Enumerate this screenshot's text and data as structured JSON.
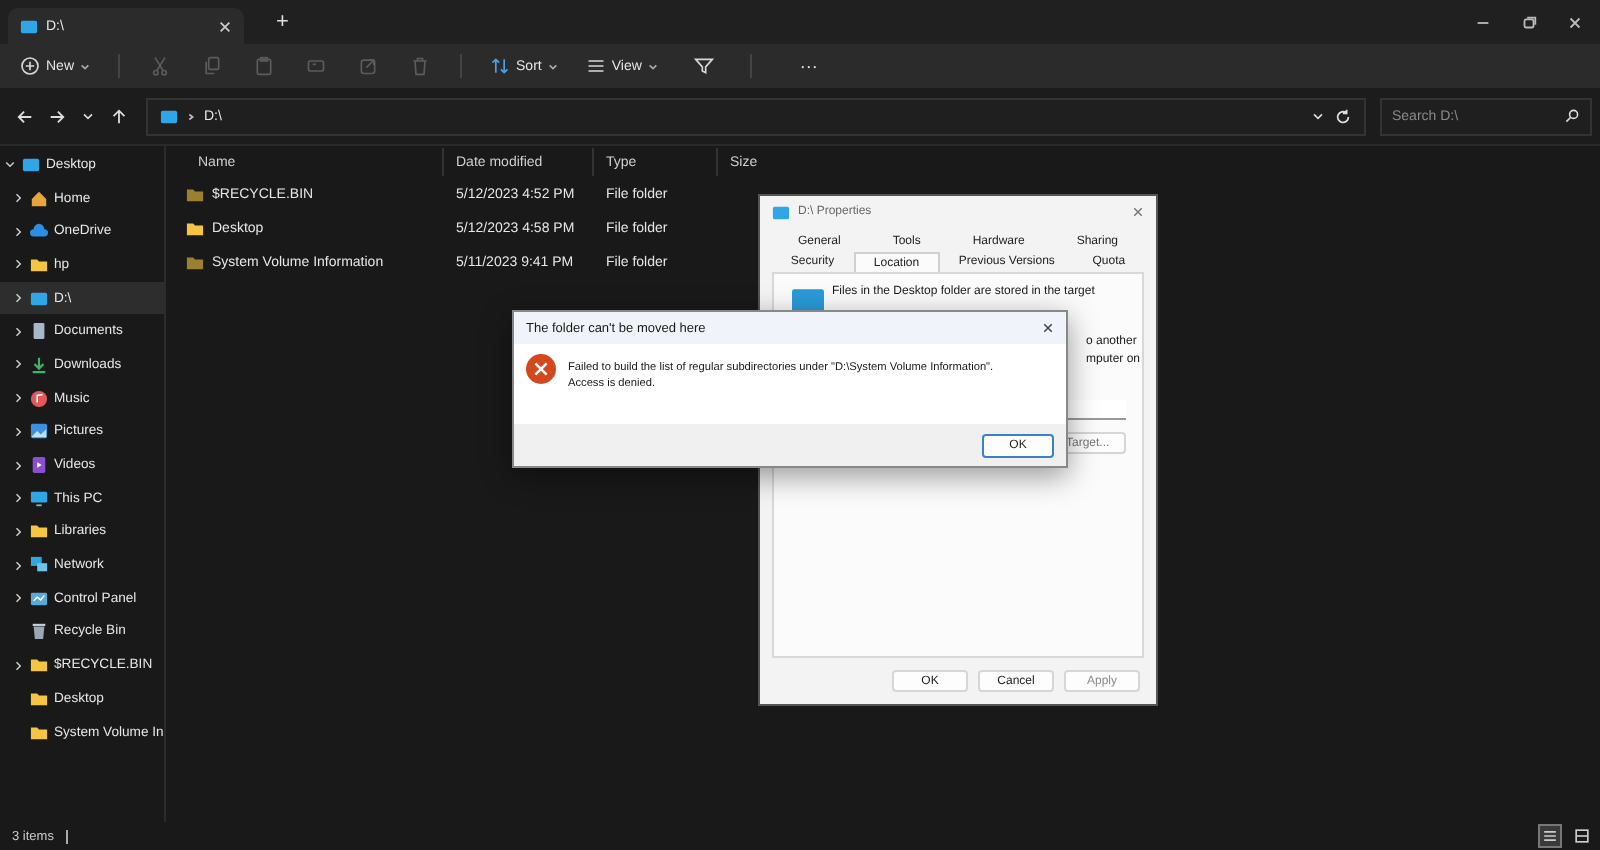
{
  "window": {
    "tab_title": "D:\\",
    "new_tab": "+"
  },
  "toolbar": {
    "new": "New",
    "actions": [
      {
        "kind": "cut",
        "disabled": true
      },
      {
        "kind": "copy",
        "disabled": true
      },
      {
        "kind": "paste",
        "disabled": true
      },
      {
        "kind": "rename",
        "disabled": true
      },
      {
        "kind": "share",
        "disabled": true
      },
      {
        "kind": "delete",
        "disabled": true
      }
    ],
    "sort": "Sort",
    "view": "View",
    "more": "···"
  },
  "address": {
    "path": "D:\\",
    "search_placeholder": "Search D:\\"
  },
  "sidebar": {
    "items": [
      {
        "label": "Desktop",
        "kind": "desktop",
        "expanded": true,
        "has_children": true,
        "selected": false,
        "children": [
          {
            "label": "Home",
            "kind": "home",
            "has_children": true,
            "selected": false
          },
          {
            "label": "OneDrive",
            "kind": "cloud",
            "has_children": true,
            "selected": false
          },
          {
            "label": "hp",
            "kind": "folder",
            "has_children": true,
            "selected": false
          },
          {
            "label": "D:\\",
            "kind": "drive",
            "has_children": true,
            "selected": true
          },
          {
            "label": "Documents",
            "kind": "documents",
            "has_children": true,
            "selected": false
          },
          {
            "label": "Downloads",
            "kind": "downloads",
            "has_children": true,
            "selected": false
          },
          {
            "label": "Music",
            "kind": "music",
            "has_children": true,
            "selected": false
          },
          {
            "label": "Pictures",
            "kind": "pictures",
            "has_children": true,
            "selected": false
          },
          {
            "label": "Videos",
            "kind": "videos",
            "has_children": true,
            "selected": false
          },
          {
            "label": "This PC",
            "kind": "pc",
            "has_children": true,
            "selected": false
          },
          {
            "label": "Libraries",
            "kind": "folder",
            "has_children": true,
            "selected": false
          },
          {
            "label": "Network",
            "kind": "network",
            "has_children": true,
            "selected": false
          },
          {
            "label": "Control Panel",
            "kind": "control",
            "has_children": true,
            "selected": false
          },
          {
            "label": "Recycle Bin",
            "kind": "bin",
            "has_children": false,
            "selected": false
          },
          {
            "label": "$RECYCLE.BIN",
            "kind": "folder",
            "has_children": true,
            "selected": false
          },
          {
            "label": "Desktop",
            "kind": "folder",
            "has_children": false,
            "selected": false
          },
          {
            "label": "System Volume In",
            "kind": "folder",
            "has_children": false,
            "selected": false
          }
        ]
      }
    ]
  },
  "table": {
    "columns": [
      "Name",
      "Date modified",
      "Type",
      "Size"
    ],
    "rows": [
      {
        "name": "$RECYCLE.BIN",
        "date": "5/12/2023 4:52 PM",
        "type": "File folder",
        "hidden": true
      },
      {
        "name": "Desktop",
        "date": "5/12/2023 4:58 PM",
        "type": "File folder",
        "hidden": false
      },
      {
        "name": "System Volume Information",
        "date": "5/11/2023 9:41 PM",
        "type": "File folder",
        "hidden": true
      }
    ]
  },
  "status_bar": {
    "count": "3 items",
    "views": [
      {
        "kind": "details",
        "selected": true
      },
      {
        "kind": "tiles",
        "selected": false
      }
    ]
  },
  "properties": {
    "title": "D:\\ Properties",
    "tab_rows": [
      [
        {
          "label": "General",
          "selected": false
        },
        {
          "label": "Tools",
          "selected": false
        },
        {
          "label": "Hardware",
          "selected": false
        },
        {
          "label": "Sharing",
          "selected": false
        }
      ],
      [
        {
          "label": "Security",
          "selected": false
        },
        {
          "label": "Location",
          "selected": true
        },
        {
          "label": "Previous Versions",
          "selected": false
        },
        {
          "label": "Quota",
          "selected": false
        }
      ]
    ],
    "description": "Files in the Desktop folder are stored in the target",
    "fragments": [
      "o another",
      "mputer on"
    ],
    "target_button": "Target...",
    "buttons": [
      {
        "label": "OK",
        "disabled": false
      },
      {
        "label": "Cancel",
        "disabled": false
      },
      {
        "label": "Apply",
        "disabled": true
      }
    ]
  },
  "error_dialog": {
    "title": "The folder can't be moved here",
    "message": "Failed to build the list of regular subdirectories under \"D:\\System Volume Information\".\nAccess is denied.",
    "button": "OK"
  }
}
